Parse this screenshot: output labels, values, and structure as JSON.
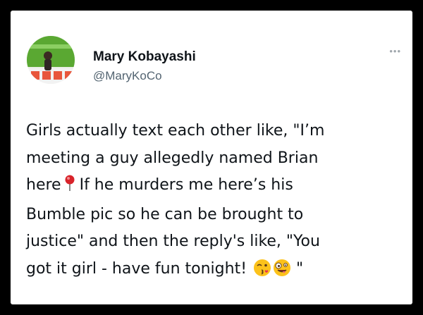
{
  "tweet": {
    "author": {
      "name": "Mary Kobayashi",
      "handle": "@MaryKoCo"
    },
    "more_icon": "more-dots-icon",
    "body_lines": [
      [
        "Girls actually text each other like, \"I’m"
      ],
      [
        "meeting a guy allegedly named Brian"
      ],
      [
        "here",
        "If he murders me here’s his"
      ],
      [
        "Bumble pic so he can be brought to"
      ],
      [
        "justice\" and then the reply's like, \"You"
      ],
      [
        "got it girl - have fun tonight!",
        "\""
      ]
    ],
    "emojis": [
      "round-pushpin-emoji",
      "kissing-face-emoji",
      "zany-face-emoji"
    ]
  },
  "colors": {
    "frame": "#000000",
    "card": "#ffffff",
    "text": "#0f1419",
    "secondary_text": "#536471",
    "avatar_green": "#5aa832",
    "pin_red": "#d8232a",
    "emoji_yellow": "#fcc21b"
  }
}
